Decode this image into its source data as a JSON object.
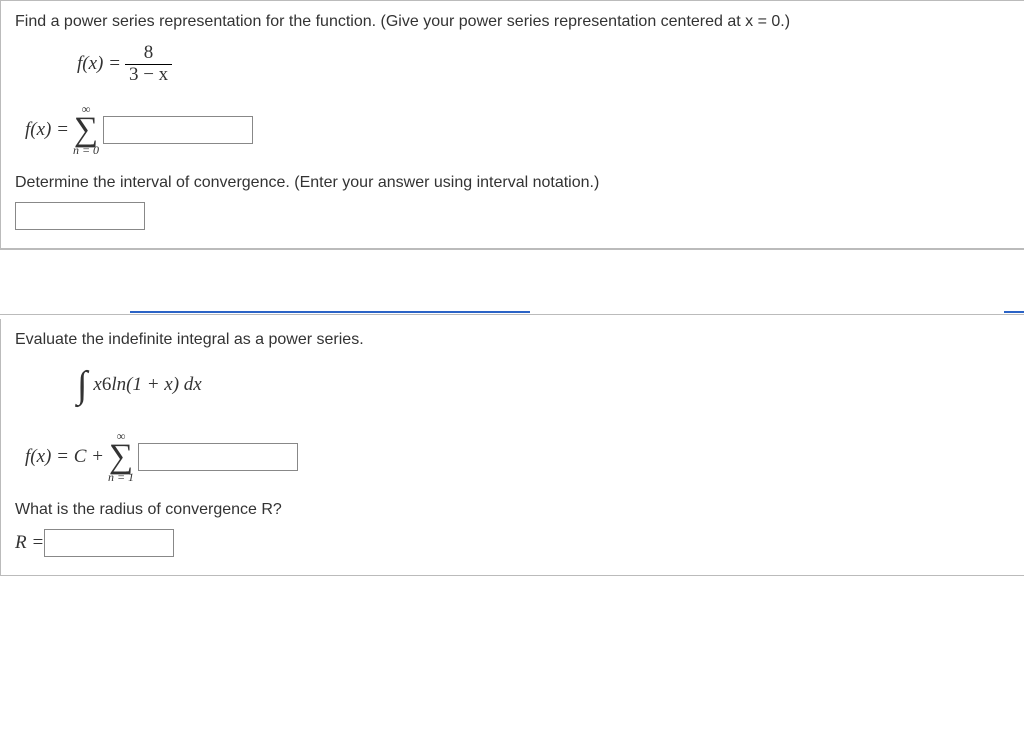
{
  "p1": {
    "prompt": "Find a power series representation for the function. (Give your power series representation centered at x = 0.)",
    "fx_lhs": "f(x) = ",
    "frac_num": "8",
    "frac_den": "3 − x",
    "ans_lhs": "f(x) = ",
    "sigma_top": "∞",
    "sigma_bot": "n = 0",
    "sub_prompt": "Determine the interval of convergence. (Enter your answer using interval notation.)"
  },
  "p2": {
    "prompt": "Evaluate the indefinite integral as a power series.",
    "integrand_pre": "x",
    "integrand_exp": "6",
    "integrand_post": " ln(1 + x) dx",
    "ans_lhs": "f(x) = C + ",
    "sigma_top": "∞",
    "sigma_bot": "n = 1",
    "sub_prompt": "What is the radius of convergence R?",
    "r_lhs": "R = "
  }
}
